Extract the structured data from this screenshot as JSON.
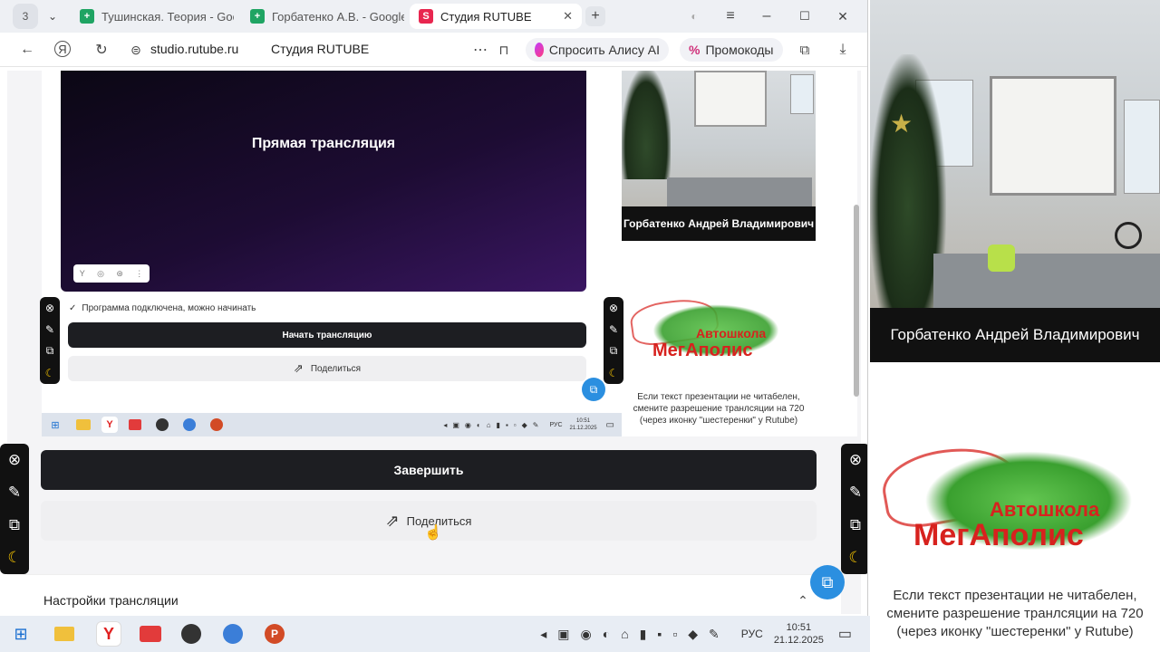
{
  "tabs": [
    {
      "count": "3"
    },
    {
      "title": "Тушинская. Теория - Goo"
    },
    {
      "title": "Горбатенко А.В. - Google"
    },
    {
      "title": "Студия RUTUBE"
    }
  ],
  "address": {
    "url": "studio.rutube.ru",
    "page_title": "Студия RUTUBE",
    "alice": "Спросить Алису AI",
    "promo": "Промокоды"
  },
  "stream": {
    "preview_title": "Прямая трансляция",
    "status_text": "Программа подключена, можно начинать",
    "start_button": "Начать трансляцию",
    "share_small": "Поделиться",
    "finish_button": "Завершить",
    "share_button": "Поделиться",
    "settings_label": "Настройки трансляции"
  },
  "presenter": {
    "name": "Горбатенко Андрей Владимирович"
  },
  "logo": {
    "top": "Автошкола",
    "bottom": "МегАполис"
  },
  "notice": {
    "text": "Если текст презентации не читабелен, смените разрешение транлсяции на 720 (через иконку \"шестеренки\" у Rutube)"
  },
  "taskbar": {
    "lang": "РУС",
    "time": "10:51",
    "date": "21.12.2025"
  },
  "icons": [
    "grid-icon",
    "back-icon",
    "yandex-icon",
    "reload-icon",
    "tune-icon",
    "more-icon",
    "bookmark-icon",
    "alice-icon",
    "percent-icon",
    "collections-icon",
    "download-icon",
    "close-circle-icon",
    "pen-icon",
    "crop-icon",
    "lasso-icon",
    "share-icon",
    "chat-icon",
    "chevron-up-icon",
    "windows-icon"
  ],
  "colors": {
    "dark_button": "#1d1e22",
    "light_button": "#efeff1",
    "logo_green": "#3aa02f",
    "logo_red": "#d7221e",
    "accent_rutube": "#e8264f"
  }
}
